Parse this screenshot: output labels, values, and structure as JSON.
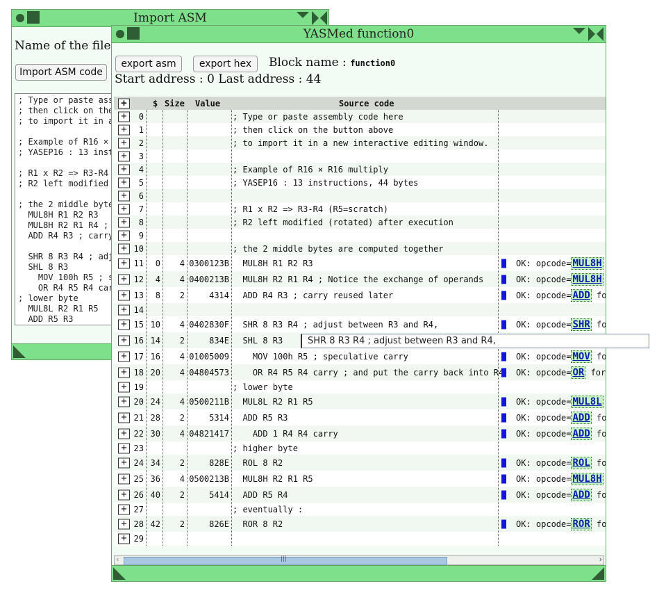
{
  "import_window": {
    "title": "Import ASM",
    "prompt": "Name of the file t",
    "import_button": "Import ASM code",
    "textarea_lines": [
      "; Type or paste asse",
      "; then click on the",
      "; to import it in a",
      "",
      "; Example of R16 × R",
      "; YASEP16 : 13 instru",
      "",
      "; R1 x R2 => R3-R4",
      "; R2 left modified",
      "",
      "; the 2 middle bytes",
      "  MUL8H R1 R2 R3",
      "  MUL8H R2 R1 R4 ; N",
      "  ADD R4 R3 ; carry",
      "",
      "  SHR 8 R3 R4 ; adju",
      "  SHL 8 R3",
      "    MOV 100h R5 ; sp",
      "    OR R4 R5 R4 carr",
      "; lower byte",
      "  MUL8L R2 R1 R5",
      "  ADD R5 R3"
    ]
  },
  "yasmed_window": {
    "title": "YASMed function0",
    "export_asm": "export asm",
    "export_hex": "export hex",
    "block_name_label": "Block name :",
    "block_name_value": "function0",
    "start_label": "Start address :",
    "start_value": "0",
    "last_label": "Last address :",
    "last_value": "44",
    "columns": {
      "plus": "+",
      "dollar": "$",
      "size": "Size",
      "value": "Value",
      "source": "Source code"
    },
    "rows": [
      {
        "n": "0",
        "addr": "",
        "size": "",
        "value": "",
        "src": "; Type or paste assembly code here",
        "ok": false,
        "op": ""
      },
      {
        "n": "1",
        "addr": "",
        "size": "",
        "value": "",
        "src": "; then click on the button above",
        "ok": false,
        "op": ""
      },
      {
        "n": "2",
        "addr": "",
        "size": "",
        "value": "",
        "src": "; to import it in a new interactive editing window.",
        "ok": false,
        "op": ""
      },
      {
        "n": "3",
        "addr": "",
        "size": "",
        "value": "",
        "src": "",
        "ok": false,
        "op": ""
      },
      {
        "n": "4",
        "addr": "",
        "size": "",
        "value": "",
        "src": "; Example of R16 × R16 multiply",
        "ok": false,
        "op": ""
      },
      {
        "n": "5",
        "addr": "",
        "size": "",
        "value": "",
        "src": "; YASEP16 : 13 instructions, 44 bytes",
        "ok": false,
        "op": ""
      },
      {
        "n": "6",
        "addr": "",
        "size": "",
        "value": "",
        "src": "",
        "ok": false,
        "op": ""
      },
      {
        "n": "7",
        "addr": "",
        "size": "",
        "value": "",
        "src": "; R1 x R2 => R3-R4 (R5=scratch)",
        "ok": false,
        "op": ""
      },
      {
        "n": "8",
        "addr": "",
        "size": "",
        "value": "",
        "src": "; R2 left modified (rotated) after execution",
        "ok": false,
        "op": ""
      },
      {
        "n": "9",
        "addr": "",
        "size": "",
        "value": "",
        "src": "",
        "ok": false,
        "op": ""
      },
      {
        "n": "10",
        "addr": "",
        "size": "",
        "value": "",
        "src": "; the 2 middle bytes are computed together",
        "ok": false,
        "op": ""
      },
      {
        "n": "11",
        "addr": "0",
        "size": "4",
        "value": "0300123B",
        "src": "  MUL8H R1 R2 R3",
        "ok": true,
        "op": "MUL8H",
        "tail": ""
      },
      {
        "n": "12",
        "addr": "4",
        "size": "4",
        "value": "0400213B",
        "src": "  MUL8H R2 R1 R4 ; Notice the exchange of operands",
        "ok": true,
        "op": "MUL8H",
        "tail": ""
      },
      {
        "n": "13",
        "addr": "8",
        "size": "2",
        "value": "4314",
        "src": "  ADD R4 R3 ; carry reused later",
        "ok": true,
        "op": "ADD",
        "tail": " fo"
      },
      {
        "n": "14",
        "addr": "",
        "size": "",
        "value": "",
        "src": "",
        "ok": false,
        "op": ""
      },
      {
        "n": "15",
        "addr": "10",
        "size": "4",
        "value": "0402830F",
        "src": "  SHR 8 R3 R4 ; adjust between R3 and R4,",
        "ok": true,
        "op": "SHR",
        "tail": " fo"
      },
      {
        "n": "16",
        "addr": "14",
        "size": "2",
        "value": "834E",
        "src": "  SHL 8 R3",
        "ok": false,
        "op": ""
      },
      {
        "n": "17",
        "addr": "16",
        "size": "4",
        "value": "01005009",
        "src": "    MOV 100h R5 ; speculative carry",
        "ok": true,
        "op": "MOV",
        "tail": " fo"
      },
      {
        "n": "18",
        "addr": "20",
        "size": "4",
        "value": "04804573",
        "src": "    OR R4 R5 R4 carry ; and put the carry back into R4",
        "ok": true,
        "op": "OR",
        "tail": " for"
      },
      {
        "n": "19",
        "addr": "",
        "size": "",
        "value": "",
        "src": "; lower byte",
        "ok": false,
        "op": ""
      },
      {
        "n": "20",
        "addr": "24",
        "size": "4",
        "value": "0500211B",
        "src": "  MUL8L R2 R1 R5",
        "ok": true,
        "op": "MUL8L",
        "tail": ""
      },
      {
        "n": "21",
        "addr": "28",
        "size": "2",
        "value": "5314",
        "src": "  ADD R5 R3",
        "ok": true,
        "op": "ADD",
        "tail": " fo"
      },
      {
        "n": "22",
        "addr": "30",
        "size": "4",
        "value": "04821417",
        "src": "    ADD 1 R4 R4 carry",
        "ok": true,
        "op": "ADD",
        "tail": " fo"
      },
      {
        "n": "23",
        "addr": "",
        "size": "",
        "value": "",
        "src": "; higher byte",
        "ok": false,
        "op": ""
      },
      {
        "n": "24",
        "addr": "34",
        "size": "2",
        "value": "828E",
        "src": "  ROL 8 R2",
        "ok": true,
        "op": "ROL",
        "tail": " fo"
      },
      {
        "n": "25",
        "addr": "36",
        "size": "4",
        "value": "0500213B",
        "src": "  MUL8H R2 R1 R5",
        "ok": true,
        "op": "MUL8H",
        "tail": ""
      },
      {
        "n": "26",
        "addr": "40",
        "size": "2",
        "value": "5414",
        "src": "  ADD R5 R4",
        "ok": true,
        "op": "ADD",
        "tail": " fo"
      },
      {
        "n": "27",
        "addr": "",
        "size": "",
        "value": "",
        "src": "; eventually :",
        "ok": false,
        "op": ""
      },
      {
        "n": "28",
        "addr": "42",
        "size": "2",
        "value": "826E",
        "src": "  ROR 8 R2",
        "ok": true,
        "op": "ROR",
        "tail": " fo"
      },
      {
        "n": "29",
        "addr": "",
        "size": "",
        "value": "",
        "src": "",
        "ok": false,
        "op": ""
      }
    ],
    "ok_prefix": "OK: opcode=",
    "edit_value": "SHR 8 R3 R4 ; adjust between R3 and R4,",
    "scroll_grip": "|||"
  },
  "colors": {
    "titlebar": "#7ee08a",
    "window_bg": "#f2fcf4",
    "opcode_link": "#0a1fa8",
    "marker": "#1414e0"
  }
}
